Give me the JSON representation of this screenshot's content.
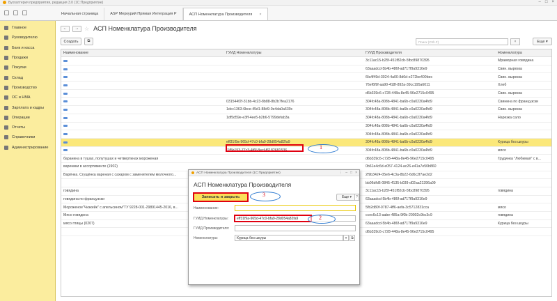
{
  "app": {
    "title": "Бухгалтерия предприятия, редакция 3.0 (1С:Предприятие)"
  },
  "tabs": [
    {
      "label": "Начальная страница"
    },
    {
      "label": "ASP Меркурий Прямая Интеграция Р"
    },
    {
      "label": "АСП Номенклатура Производителя"
    }
  ],
  "sidebar": {
    "items": [
      {
        "label": "Главное"
      },
      {
        "label": "Руководителю"
      },
      {
        "label": "Банк и касса"
      },
      {
        "label": "Продажи"
      },
      {
        "label": "Покупки"
      },
      {
        "label": "Склад"
      },
      {
        "label": "Производство"
      },
      {
        "label": "ОС и НМА"
      },
      {
        "label": "Зарплата и кадры"
      },
      {
        "label": "Операции"
      },
      {
        "label": "Отчеты"
      },
      {
        "label": "Справочники"
      },
      {
        "label": "Администрирование"
      }
    ]
  },
  "page": {
    "title": "АСП Номенклатура Производителя",
    "create_label": "Создать",
    "search_placeholder": "Поиск (Ctrl+F)",
    "search_glyph": "×",
    "more_label": "Еще ▾"
  },
  "grid": {
    "headers": [
      "Наименование",
      "ГУИД Номенклатуры",
      "ГУИД Производителя",
      "Номенклатура"
    ],
    "selected_index": 10,
    "rows": [
      {
        "icon": true,
        "name": "",
        "guid_nom": "",
        "guid_prod": "3c11ac15-b25f-451f82cb-5fbc89870395",
        "nom": "Мраморная говядина"
      },
      {
        "icon": true,
        "name": "",
        "guid_nom": "",
        "guid_prod": "63aaadcd-5b4b-486f-ad717f9a9316e9",
        "nom": "Свин. вырезка"
      },
      {
        "icon": true,
        "name": "",
        "guid_nom": "",
        "guid_prod": "6fa4f49d-3024-4a00-8d6d-e272be400bec",
        "nom": "Свин. вырезка"
      },
      {
        "icon": true,
        "name": "",
        "guid_nom": "",
        "guid_prod": "76ef6f9f-aa90-418f-892a-39cc195a6011",
        "nom": "Хлеб"
      },
      {
        "icon": true,
        "name": "",
        "guid_nom": "",
        "guid_prod": "d6b339c6-c728-448a-8e45-96e2715c0495",
        "nom": "Свин. вырезка"
      },
      {
        "icon": true,
        "name": "",
        "guid_nom": "031544f2f-31bb-4c23-8b88-8b2b7fea2176",
        "guid_prod": "304fc48a-808b-4841-ba6b-c0a0230a4fd9",
        "nom": "Свинина по французски"
      },
      {
        "icon": true,
        "name": "",
        "guid_nom": "1dcc1363-6bce-45d1-88d9-0e4da0a639c",
        "guid_prod": "304fc48a-808b-4841-ba6b-c0a0230a4fd9",
        "nom": "Свин. вырезка"
      },
      {
        "icon": true,
        "name": "",
        "guid_nom": "1df5d59e-e3ff-4ee5-b2b6-5799defab3a",
        "guid_prod": "304fc48a-808b-4841-ba6b-c0a0230a4fd9",
        "nom": "Нарезка сало"
      },
      {
        "icon": true,
        "name": "",
        "guid_nom": "",
        "guid_prod": "304fc48a-808b-4841-ba6b-c0a0230a4fd9",
        "nom": ""
      },
      {
        "icon": true,
        "name": "",
        "guid_nom": "",
        "guid_prod": "304fc48a-808b-4841-ba6b-c0a0230a4fd9",
        "nom": ""
      },
      {
        "icon": true,
        "name": "",
        "guid_nom": "eff31f9a-965d-47c0-bfa9-28d054a82fa9",
        "guid_prod": "304fc48a-808b-4841-ba6b-c0a0230a4fd9",
        "nom": "Курица без шкуры"
      },
      {
        "icon": true,
        "name": "",
        "guid_nom": "f1f5b153-77c3-4f6f-8ecf-f6182681536",
        "guid_prod": "304fc48a-808b-4841-ba6b-c0a0230a4fd9",
        "nom": "мясо"
      },
      {
        "icon": false,
        "name": "баранина в тушах, полутушах и четвертинах мороженая",
        "guid_nom": "",
        "guid_prod": "d6b339c6-c728-448a-8e45-96e2715c0495",
        "nom": "Грудинка \"Любимая\" с в..."
      },
      {
        "icon": false,
        "name": "вареники в ассортименте (1902)",
        "guid_nom": "",
        "guid_prod": "0b61e4c6d-e057-4124-ac26-e41a7e50b860",
        "nom": ""
      },
      {
        "icon": false,
        "name": "Варёнка. Сгущёнка вареная с сахаром с заменителем молочного...",
        "guid_nom": "",
        "guid_prod": "2f9b3424-05e6-4c3a-8b22-6d6c2f7ae2d2",
        "nom": ""
      },
      {
        "icon": false,
        "name": "",
        "guid_nom": "",
        "guid_prod": "bb06dfd6-0845-4135-b039-d02aa21396a09",
        "nom": ""
      },
      {
        "icon": false,
        "name": "говядина",
        "guid_nom": "",
        "guid_prod": "3c11ac15-b25f-451f82cb-5fbc89870395",
        "nom": "говядина"
      },
      {
        "icon": false,
        "name": "говядина по французски",
        "guid_nom": "",
        "guid_prod": "63aaadcd-5b4b-486f-ad717f9a9316e9",
        "nom": ""
      },
      {
        "icon": false,
        "name": "Мороженое\"Чизкейк\" с апельсином\"ТУ 9228-001-29891445-2016, в...",
        "guid_nom": "",
        "guid_prod": "5fb2d80f-0787-4ff6-aefa-3c5712831cca",
        "nom": "мясо"
      },
      {
        "icon": false,
        "name": "Мясо говядина",
        "guid_nom": "",
        "guid_prod": "ccec6c13-aabe-485a-9f0b-20002c9bc3c9",
        "nom": "говядина"
      },
      {
        "icon": false,
        "name": "мясо птицы (0207)",
        "guid_nom": "",
        "guid_prod": "63aaadcd-5b4b-486f-ad717f9a9316e9",
        "nom": "Курица без шкуры"
      },
      {
        "icon": false,
        "name": "",
        "guid_nom": "",
        "guid_prod": "d6b339c6-c728-448a-8e45-96e2715c0495",
        "nom": ""
      }
    ]
  },
  "dialog": {
    "title": "АСП Номенклатура Производителя (1С:Предприятие)",
    "heading": "АСП Номенклатура Производителя",
    "save_close_label": "Записать и закрыть",
    "more_label": "Еще ▾",
    "fields": {
      "name_label": "Наименование:",
      "name_value": "",
      "guid_nom_label": "ГУИД Номенклатуры:",
      "guid_nom_value": "eff31f9a-965d-47c0-bfa9-28d054a82fa9",
      "guid_prod_label": "ГУИД Производителя:",
      "guid_prod_value": "",
      "nom_label": "Номенклатура:",
      "nom_value": "Курица без шкуры"
    }
  },
  "annotations": {
    "one": "1",
    "two": "2",
    "three": "3",
    "highlight_color": "#e00010",
    "oval_color": "#2a78d0"
  }
}
